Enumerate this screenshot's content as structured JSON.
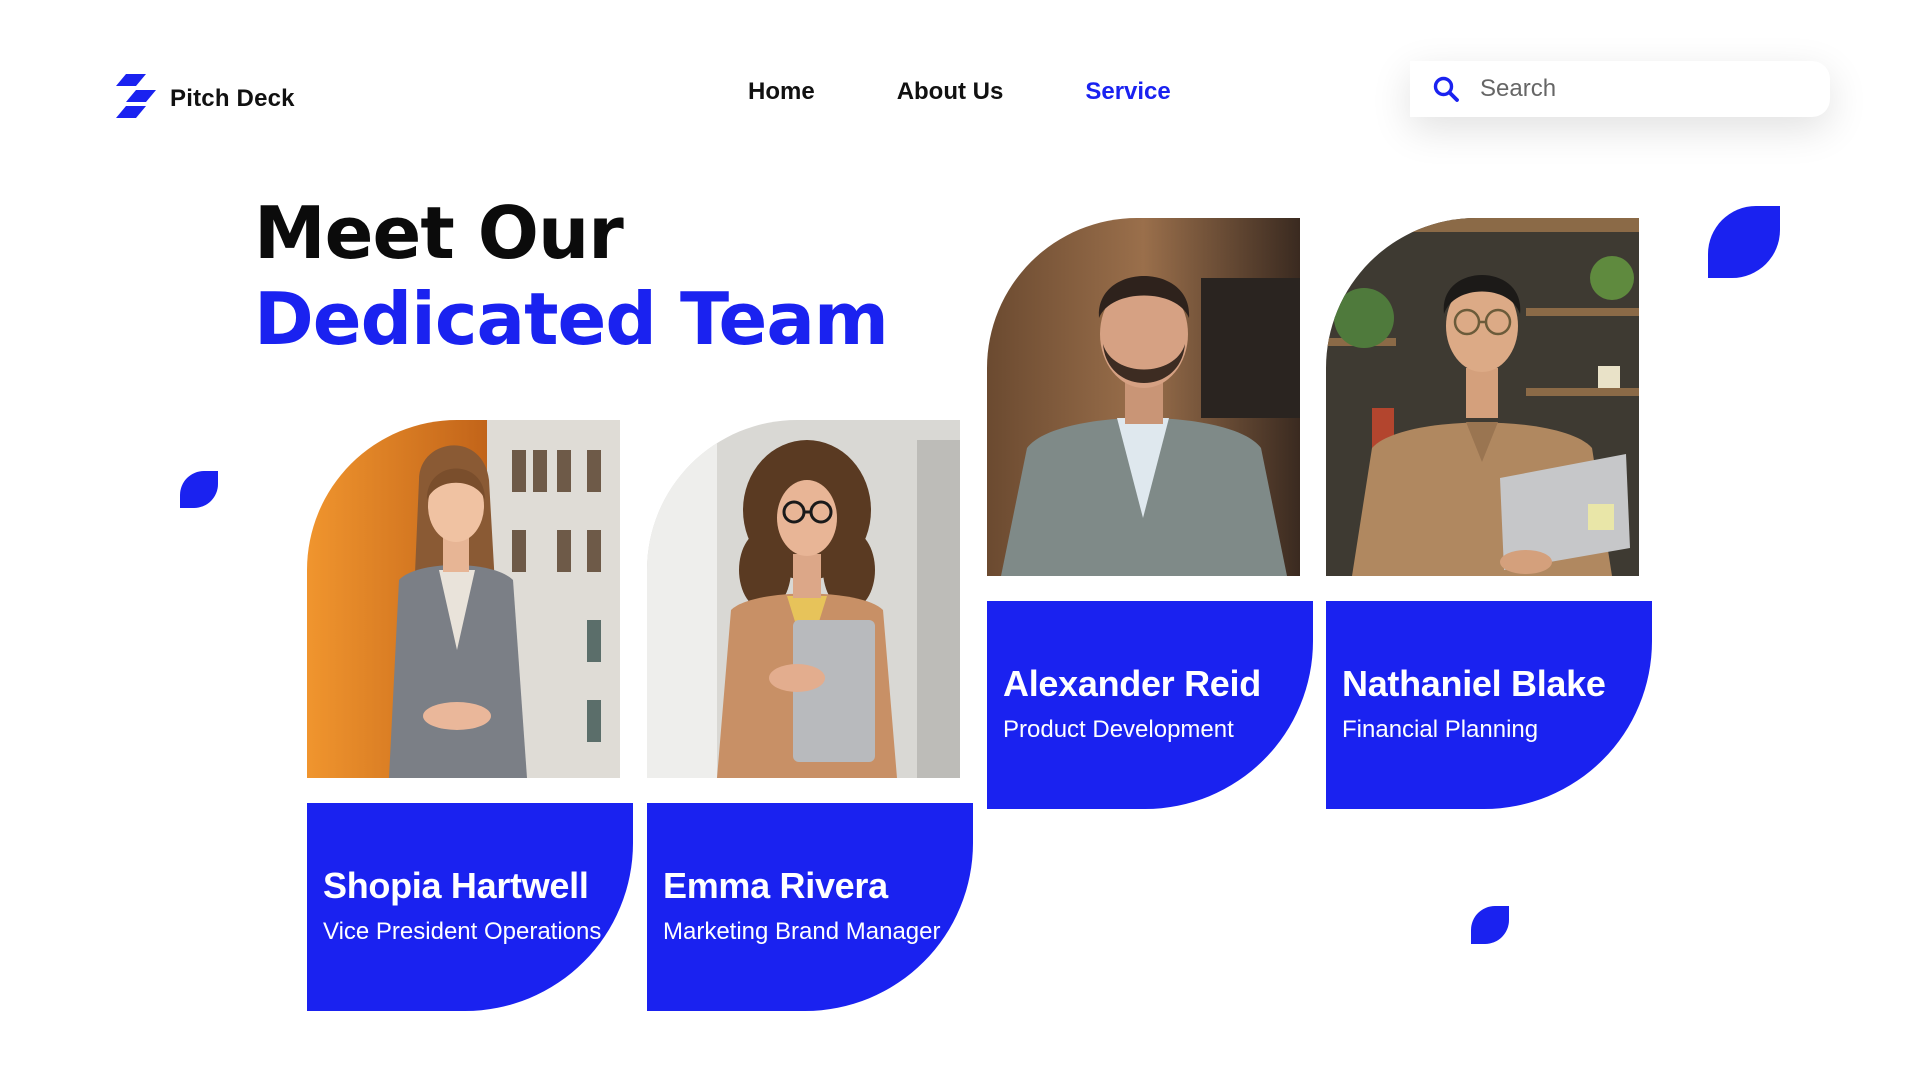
{
  "brand": {
    "name": "Pitch Deck",
    "logo_icon": "stripes-logo-icon",
    "color": "#1a22f0"
  },
  "nav": {
    "items": [
      {
        "label": "Home",
        "active": false
      },
      {
        "label": "About Us",
        "active": false
      },
      {
        "label": "Service",
        "active": true
      }
    ]
  },
  "search": {
    "placeholder": "Search",
    "value": "",
    "icon": "search-icon"
  },
  "heading": {
    "line1": "Meet Our",
    "line2": "Dedicated Team"
  },
  "colors": {
    "accent": "#1a22f0",
    "text": "#111111",
    "background": "#ffffff"
  },
  "team": [
    {
      "name": "Shopia Hartwell",
      "role": "Vice President Operations",
      "photo": "woman-gray-blazer-portrait"
    },
    {
      "name": "Emma Rivera",
      "role": "Marketing Brand Manager",
      "photo": "woman-glasses-laptop-portrait"
    },
    {
      "name": "Alexander Reid",
      "role": "Product Development",
      "photo": "man-plaid-suit-portrait"
    },
    {
      "name": "Nathaniel Blake",
      "role": "Financial Planning",
      "photo": "man-glasses-laptop-portrait"
    }
  ]
}
